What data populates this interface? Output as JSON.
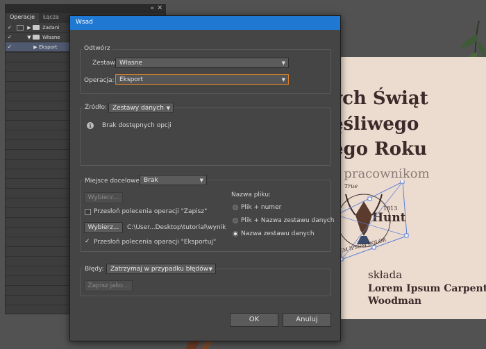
{
  "layers_panel": {
    "controls": {
      "collapse": "«",
      "close": "✕"
    },
    "tabs": [
      {
        "label": "Operacje",
        "active": true
      },
      {
        "label": "Łącza",
        "active": false
      }
    ],
    "rows": [
      {
        "label": "Zadani"
      },
      {
        "label": "Własne"
      },
      {
        "label": "Eksport"
      }
    ]
  },
  "dialog": {
    "title": "Wsad",
    "play_group": {
      "label": "Odtwórz",
      "set_label": "Zestaw:",
      "set_value": "Własne",
      "action_label": "Operacja:",
      "action_value": "Eksport"
    },
    "source_group": {
      "label": "Źródło:",
      "value": "Zestawy danych",
      "info": "Brak dostępnych opcji"
    },
    "destination_group": {
      "label": "Miejsce docelowe:",
      "value": "Brak",
      "choose_button_1": "Wybierz...",
      "override_save_label": "Przesłoń polecenia operacji \"Zapisz\"",
      "override_save_checked": false,
      "choose_button_2": "Wybierz...",
      "path": "C:\\User...Desktop\\tutorial\\wynik",
      "override_export_label": "Przesłoń polecenia oparacji \"Eksportuj\"",
      "override_export_checked": true,
      "filename_label": "Nazwa pliku:",
      "filename_options": [
        "Plik + numer",
        "Plik + Nazwa zestawu danych",
        "Nazwa zestawu danych"
      ],
      "filename_selected": 2
    },
    "errors_group": {
      "label": "Błędy:",
      "value": "Zatrzymaj w przypadku błędów",
      "save_as_button": "Zapisz jako..."
    },
    "ok_button": "OK",
    "cancel_button": "Anuluj"
  },
  "artboard": {
    "line1": "ych Świąt",
    "line2": "ęśliwego",
    "line3": "ego Roku",
    "line4": "n pracownikom",
    "logo_true": "True",
    "logo_year": "1813",
    "logo_name": "Hunt",
    "logo_ring": "EM IPSUM DOLOR",
    "line5": "składa",
    "line6": "Lorem Ipsum Carpenter",
    "line7": "Woodman"
  },
  "colors": {
    "titlebar": "#1f78d1",
    "dialog_bg": "#454545",
    "artboard_bg": "#ecdccf",
    "focus": "#d9822b",
    "selection": "#5b7fd6"
  }
}
